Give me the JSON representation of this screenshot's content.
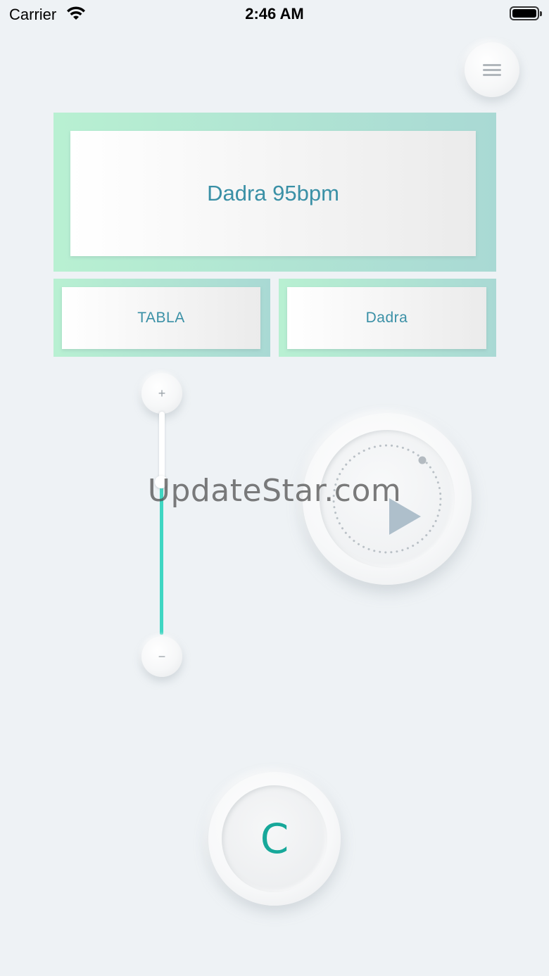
{
  "status_bar": {
    "carrier": "Carrier",
    "time": "2:46 AM"
  },
  "rhythm": {
    "title": "Dadra 95bpm",
    "instrument": "TABLA",
    "taal": "Dadra"
  },
  "tempo_slider": {
    "plus_label": "+",
    "minus_label": "−",
    "accent_color": "#3fd6c2",
    "level_fraction": 0.68
  },
  "key_button": {
    "label": "C",
    "color": "#17a89a"
  },
  "watermark": "UpdateStar.com",
  "colors": {
    "background": "#eef2f5",
    "text_accent": "#3a90a6",
    "frame_gradient_start": "#b8f0d2",
    "frame_gradient_end": "#a9d9d4"
  }
}
